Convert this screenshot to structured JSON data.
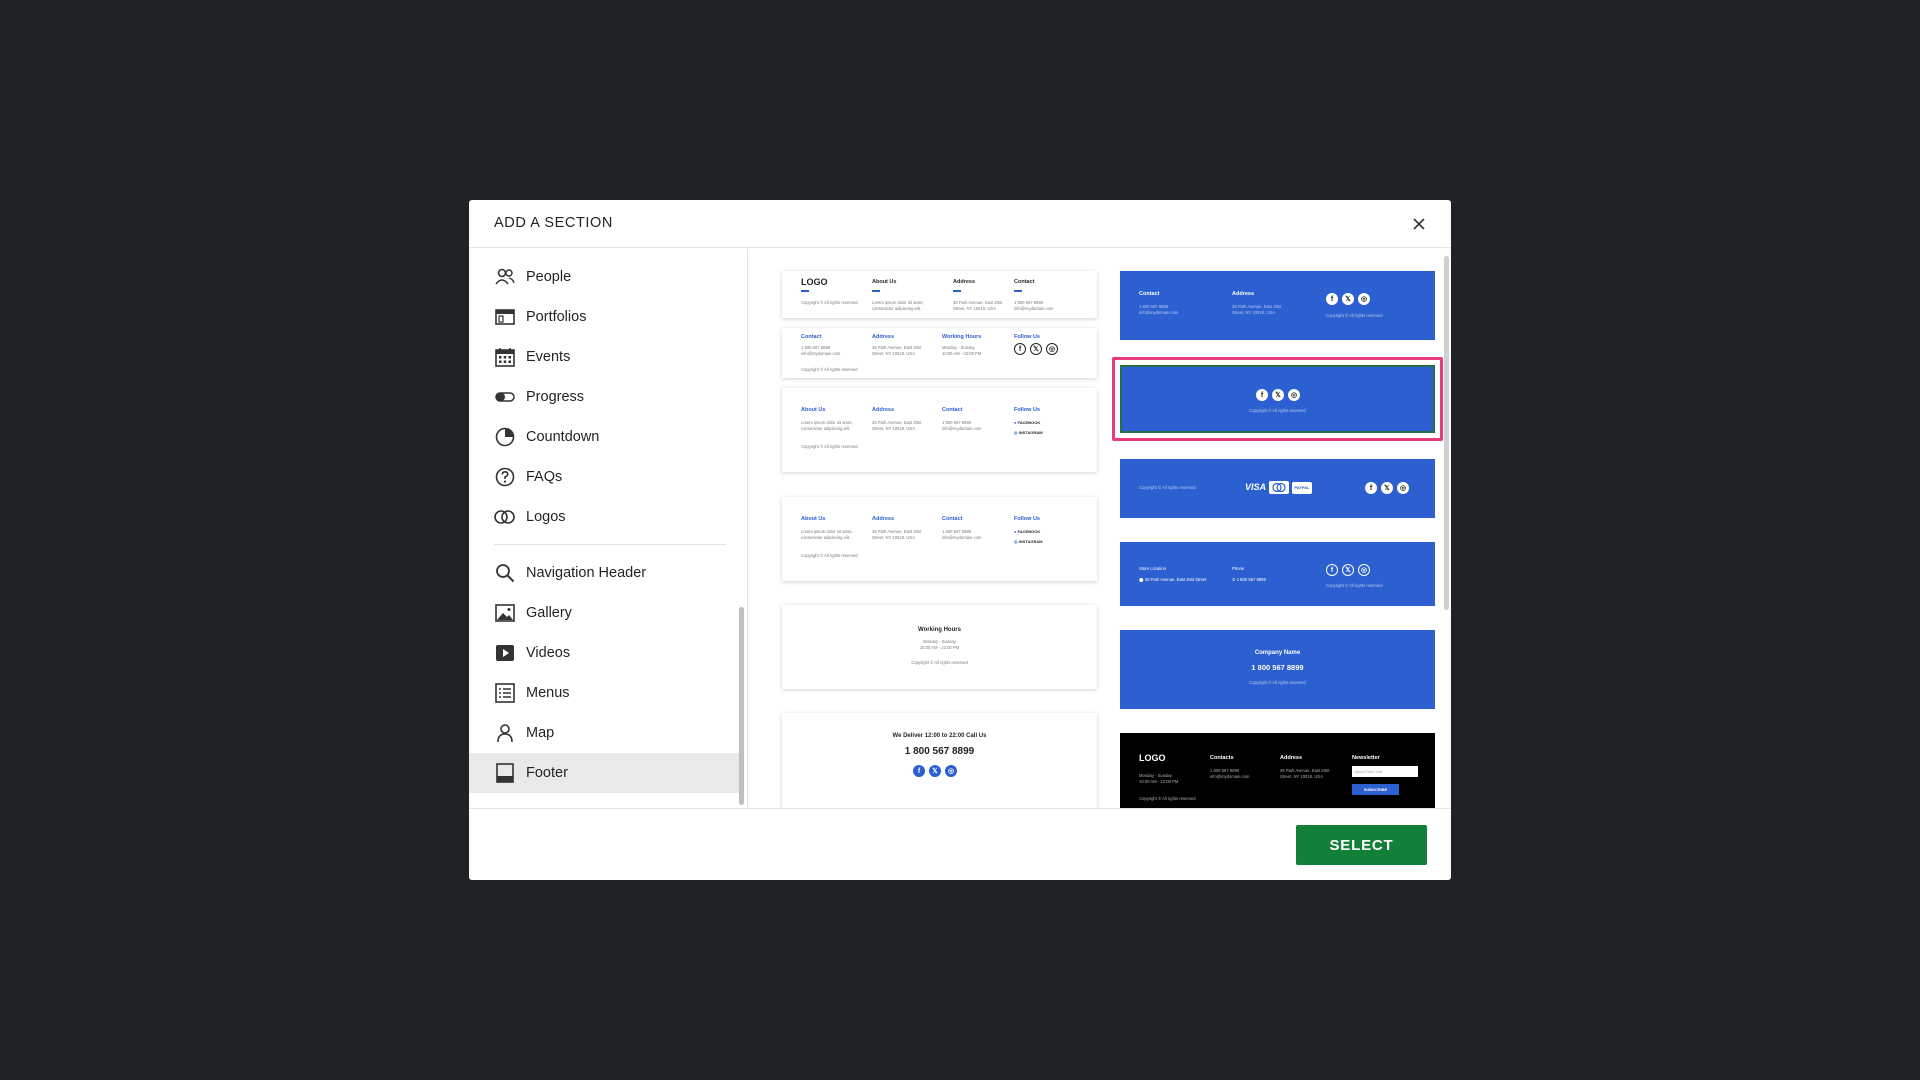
{
  "modal": {
    "title": "ADD A SECTION",
    "select_label": "SELECT"
  },
  "sidebar": {
    "items": [
      {
        "label": "People",
        "icon": "people-icon"
      },
      {
        "label": "Portfolios",
        "icon": "portfolio-icon"
      },
      {
        "label": "Events",
        "icon": "calendar-icon"
      },
      {
        "label": "Progress",
        "icon": "progress-icon"
      },
      {
        "label": "Countdown",
        "icon": "countdown-icon"
      },
      {
        "label": "FAQs",
        "icon": "question-icon"
      },
      {
        "label": "Logos",
        "icon": "logos-icon"
      },
      {
        "label": "Navigation Header",
        "icon": "search-icon"
      },
      {
        "label": "Gallery",
        "icon": "gallery-icon"
      },
      {
        "label": "Videos",
        "icon": "video-icon"
      },
      {
        "label": "Menus",
        "icon": "menu-list-icon"
      },
      {
        "label": "Map",
        "icon": "map-pin-icon"
      },
      {
        "label": "Footer",
        "icon": "footer-icon"
      }
    ],
    "active": "Footer"
  },
  "templates": {
    "t1": {
      "logo": "LOGO",
      "about": "About Us",
      "address": "Address",
      "contact": "Contact",
      "about_text": "Lorem ipsum dolor sit amet,",
      "about_text2": "consectetur adipiscing elit.",
      "addr1": "36 Park Avenue, East 20st",
      "addr2": "Street, NY 10018, USA",
      "phone": "1 800 567 8899",
      "email": "info@mydomain.com",
      "copy": "Copyright © All rights reserved"
    },
    "t2": {
      "contact": "Contact",
      "address": "Address",
      "hours": "Working Hours",
      "follow": "Follow Us",
      "phone": "1 800 567 8899",
      "email": "info@mydomain.com",
      "addr1": "36 Park Avenue, East 20st",
      "addr2": "Street, NY 10018, USA",
      "days": "Monday - Sunday",
      "time": "10:00 AM - 22:00 PM",
      "copy": "Copyright © All rights reserved"
    },
    "t3": {
      "about": "About Us",
      "address": "Address",
      "contact": "Contact",
      "follow": "Follow Us",
      "lorem1": "Lorem ipsum dolor sit amet,",
      "lorem2": "consectetur adipiscing elit.",
      "addr1": "36 Park Avenue, East 20st",
      "addr2": "Street, NY 10018, USA",
      "phone": "1 800 567 8899",
      "email": "info@mydomain.com",
      "fb": "FACEBOOK",
      "ig": "INSTAGRAM",
      "copy": "Copyright © All rights reserved"
    },
    "t5": {
      "title": "Working Hours",
      "days": "Monday - Sunday",
      "time": "10:00 AM - 22:00 PM",
      "copy": "Copyright © All rights reserved"
    },
    "t6": {
      "title": "We Deliver 12:00 to 22:00 Call Us",
      "phone": "1 800 567 8899"
    },
    "r1": {
      "contact": "Contact",
      "address": "Address",
      "phone": "1 800 567 8899",
      "email": "info@mydomain.com",
      "addr1": "36 Park Avenue, East 20st",
      "addr2": "Street, NY 10018, USA",
      "copy": "Copyright © All rights reserved"
    },
    "r2": {
      "copy": "Copyright © All rights reserved"
    },
    "r3": {
      "copy": "Copyright © All rights reserved",
      "visa": "VISA",
      "paypal": "PAYPAL"
    },
    "r4": {
      "store": "Store Location",
      "store_addr": "36 Park Avenue, East 20st Street",
      "phone_h": "Phone",
      "phone": "1 800 567 8899",
      "copy": "Copyright © All rights reserved"
    },
    "r5": {
      "company": "Company Name",
      "phone": "1 800 567 8899",
      "copy": "Copyright © All rights reserved"
    },
    "r6": {
      "logo": "LOGO",
      "contacts": "Contacts",
      "address": "Address",
      "newsletter": "Newsletter",
      "days": "Monday - Sunday",
      "time": "10:00 AM - 22:00 PM",
      "phone": "1 800 567 8899",
      "email": "info@mydomain.com",
      "addr1": "36 Park Avenue, East 20st",
      "addr2": "Street, NY 10018, USA",
      "placeholder": "Input Field Text",
      "subscribe": "SUBSCRIBE",
      "copy": "Copyright © All rights reserved"
    }
  },
  "colors": {
    "accent": "#2c5fcf",
    "selected": "#e8397c",
    "primary_button": "#13803a",
    "overlay": "#1f2226"
  }
}
